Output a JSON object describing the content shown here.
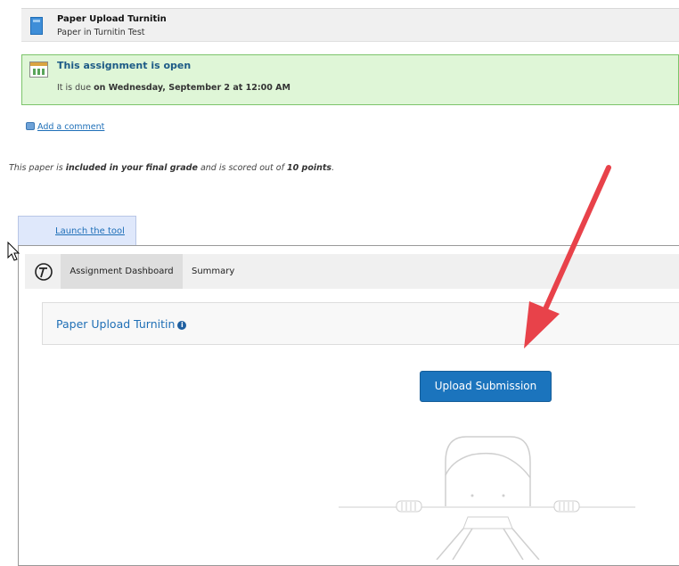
{
  "header": {
    "title": "Paper Upload Turnitin",
    "subtitle": "Paper in Turnitin Test"
  },
  "status": {
    "title": "This assignment is open",
    "due_prefix": "It is due",
    "due_date": "on Wednesday, September 2 at 12:00 AM"
  },
  "comment_link": "Add a comment",
  "grade_info": {
    "part1": "This paper is",
    "part2": "included in your final grade",
    "part3": "and is scored out of",
    "part4": "10 points",
    "part5": "."
  },
  "launch_tab": "Launch the tool",
  "tool": {
    "tabs": [
      "Assignment Dashboard",
      "Summary"
    ],
    "assignment_title": "Paper Upload Turnitin",
    "upload_button": "Upload Submission"
  },
  "colors": {
    "accent": "#1b74bd",
    "arrow": "#e8424a",
    "open_bg": "#dff6d7"
  },
  "icons": [
    "document-icon",
    "calendar-icon",
    "comment-icon",
    "turnitin-logo-icon",
    "info-icon",
    "mouse-cursor-icon"
  ]
}
